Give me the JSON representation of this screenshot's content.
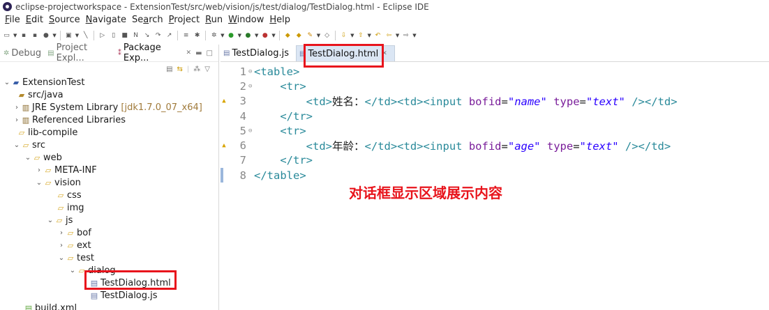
{
  "window": {
    "title": "eclipse-projectworkspace - ExtensionTest/src/web/vision/js/test/dialog/TestDialog.html - Eclipse IDE"
  },
  "menu": [
    {
      "pre": "",
      "mnemonic": "F",
      "post": "ile"
    },
    {
      "pre": "",
      "mnemonic": "E",
      "post": "dit"
    },
    {
      "pre": "",
      "mnemonic": "S",
      "post": "ource"
    },
    {
      "pre": "",
      "mnemonic": "N",
      "post": "avigate"
    },
    {
      "pre": "Se",
      "mnemonic": "a",
      "post": "rch"
    },
    {
      "pre": "",
      "mnemonic": "P",
      "post": "roject"
    },
    {
      "pre": "",
      "mnemonic": "R",
      "post": "un"
    },
    {
      "pre": "",
      "mnemonic": "W",
      "post": "indow"
    },
    {
      "pre": "",
      "mnemonic": "H",
      "post": "elp"
    }
  ],
  "views": {
    "tabs": [
      {
        "label": "Debug"
      },
      {
        "label": "Project Expl..."
      },
      {
        "label": "Package Exp..."
      }
    ]
  },
  "tree": [
    {
      "label": "ExtensionTest",
      "extra": ""
    },
    {
      "label": "src/java",
      "extra": ""
    },
    {
      "label": "JRE System Library",
      "extra": "[jdk1.7.0_07_x64]"
    },
    {
      "label": "Referenced Libraries",
      "extra": ""
    },
    {
      "label": "lib-compile",
      "extra": ""
    },
    {
      "label": "src",
      "extra": ""
    },
    {
      "label": "web",
      "extra": ""
    },
    {
      "label": "META-INF",
      "extra": ""
    },
    {
      "label": "vision",
      "extra": ""
    },
    {
      "label": "css",
      "extra": ""
    },
    {
      "label": "img",
      "extra": ""
    },
    {
      "label": "js",
      "extra": ""
    },
    {
      "label": "bof",
      "extra": ""
    },
    {
      "label": "ext",
      "extra": ""
    },
    {
      "label": "test",
      "extra": ""
    },
    {
      "label": "dialog",
      "extra": ""
    },
    {
      "label": "TestDialog.html",
      "extra": ""
    },
    {
      "label": "TestDialog.js",
      "extra": ""
    },
    {
      "label": "build.xml",
      "extra": ""
    }
  ],
  "editor": {
    "tabs": [
      {
        "label": "TestDialog.js"
      },
      {
        "label": "TestDialog.html"
      }
    ],
    "line_numbers": [
      "1",
      "2",
      "3",
      "4",
      "5",
      "6",
      "7",
      "8"
    ],
    "code": {
      "table_open": "<table>",
      "tr_open": "<tr>",
      "tr_close": "</tr>",
      "table_close": "</table>",
      "td_open": "<td>",
      "td_close": "</td>",
      "td_pair": "</td><td>",
      "input_open": "<input",
      "self_close": "/></td>",
      "attr_bofid": "bofid",
      "attr_type": "type",
      "eq": "=",
      "row1_label": "姓名：",
      "row1_bofid": "\"name\"",
      "row1_type": "\"text\"",
      "row2_label": "年龄：",
      "row2_bofid": "\"age\"",
      "row2_type": "\"text\""
    }
  },
  "annotation": "对话框显示区域展示内容",
  "colors": {
    "highlight": "#e8141c",
    "tag": "#2a8a9a",
    "attribute": "#7a1e9a",
    "string": "#2a00ff"
  }
}
